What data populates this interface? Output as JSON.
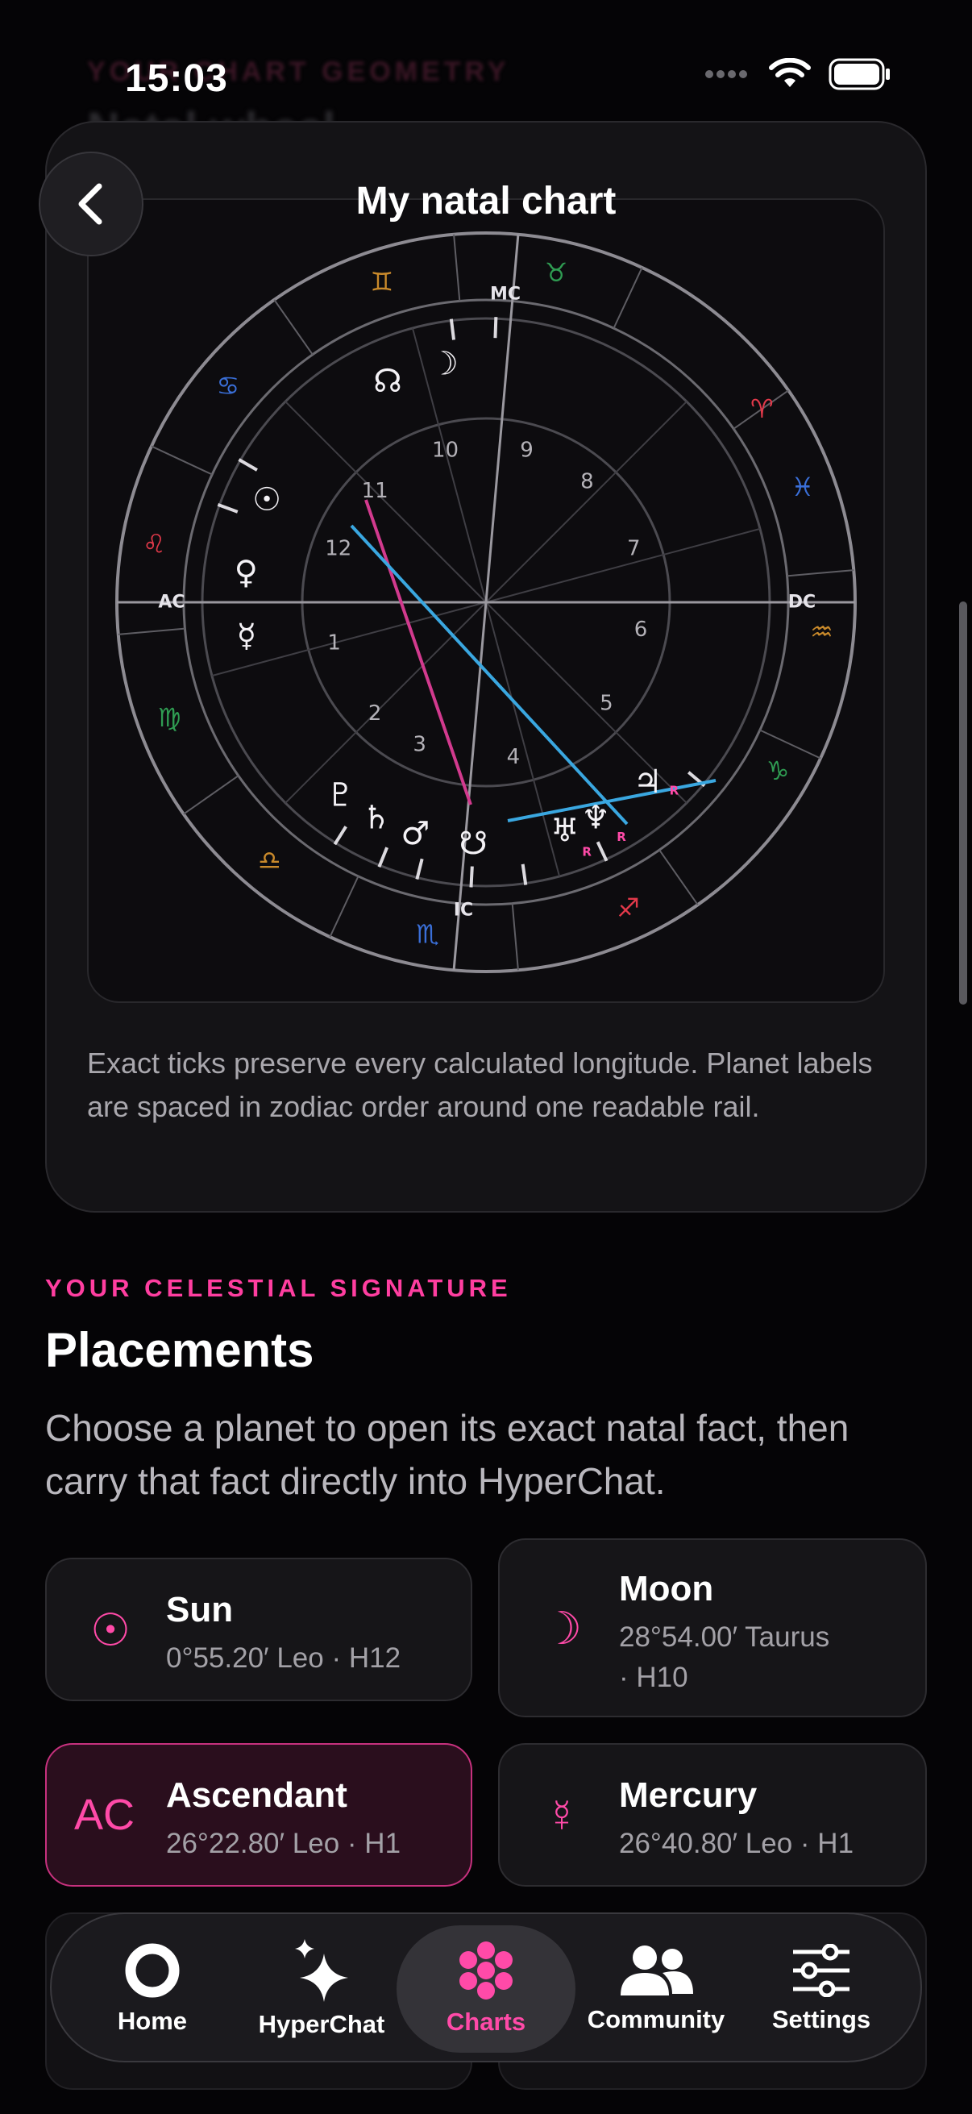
{
  "status": {
    "time": "15:03"
  },
  "ghost_header": {
    "eyebrow": "YOUR CHART GEOMETRY",
    "title": "Natal wheel"
  },
  "nav": {
    "title": "My natal chart",
    "back_icon": "chevron-left-icon"
  },
  "wheel": {
    "axis_labels": {
      "mc": "MC",
      "ic": "IC",
      "ac": "AC",
      "dc": "DC"
    },
    "houses": [
      "1",
      "2",
      "3",
      "4",
      "5",
      "6",
      "7",
      "8",
      "9",
      "10",
      "11",
      "12"
    ],
    "signs": [
      {
        "glyph": "♈",
        "color": "#e2394a"
      },
      {
        "glyph": "♉",
        "color": "#2f9c52"
      },
      {
        "glyph": "♊",
        "color": "#c98a2b"
      },
      {
        "glyph": "♋",
        "color": "#3a6fd8"
      },
      {
        "glyph": "♌",
        "color": "#e2394a"
      },
      {
        "glyph": "♍",
        "color": "#2f9c52"
      },
      {
        "glyph": "♎",
        "color": "#c98a2b"
      },
      {
        "glyph": "♏",
        "color": "#3a6fd8"
      },
      {
        "glyph": "♐",
        "color": "#e2394a"
      },
      {
        "glyph": "♑",
        "color": "#2f9c52"
      },
      {
        "glyph": "♒",
        "color": "#c98a2b"
      },
      {
        "glyph": "♓",
        "color": "#3a6fd8"
      }
    ],
    "planets": [
      {
        "glyph": "☊",
        "name": "north-node"
      },
      {
        "glyph": "☽",
        "name": "moon"
      },
      {
        "glyph": "☉",
        "name": "sun"
      },
      {
        "glyph": "♀",
        "name": "venus"
      },
      {
        "glyph": "☿",
        "name": "mercury"
      },
      {
        "glyph": "♇",
        "name": "pluto"
      },
      {
        "glyph": "♄",
        "name": "saturn"
      },
      {
        "glyph": "♂",
        "name": "mars"
      },
      {
        "glyph": "☋",
        "name": "south-node"
      },
      {
        "glyph": "♅",
        "name": "uranus"
      },
      {
        "glyph": "♆",
        "name": "neptune"
      },
      {
        "glyph": "♃",
        "name": "jupiter"
      }
    ],
    "retrograde_mark": "R",
    "aspect_colors": {
      "opposition": "#d23a8e",
      "trine": "#3aa7e0"
    }
  },
  "card_note": "Exact ticks preserve every calculated longitude. Planet labels are spaced in zodiac order around one readable rail.",
  "section": {
    "eyebrow": "YOUR CELESTIAL SIGNATURE",
    "title": "Placements",
    "description": "Choose a planet to open its exact natal fact, then carry that fact directly into HyperChat."
  },
  "placements": [
    {
      "icon": "☉",
      "name": "Sun",
      "detail": "0°55.20′ Leo · H12"
    },
    {
      "icon": "☽",
      "name": "Moon",
      "detail_line1": "28°54.00′ Taurus",
      "detail_line2": "· H10"
    },
    {
      "icon": "AC",
      "name": "Ascendant",
      "detail": "26°22.80′ Leo · H1",
      "active": true
    },
    {
      "icon": "☿",
      "name": "Mercury",
      "detail": "26°40.80′ Leo · H1"
    }
  ],
  "tabs": [
    {
      "label": "Home",
      "icon": "home-ring-icon"
    },
    {
      "label": "HyperChat",
      "icon": "sparkles-icon"
    },
    {
      "label": "Charts",
      "icon": "flower-icon",
      "active": true
    },
    {
      "label": "Community",
      "icon": "people-icon"
    },
    {
      "label": "Settings",
      "icon": "sliders-icon"
    }
  ],
  "colors": {
    "accent": "#ff4aa8",
    "background": "#050406"
  }
}
